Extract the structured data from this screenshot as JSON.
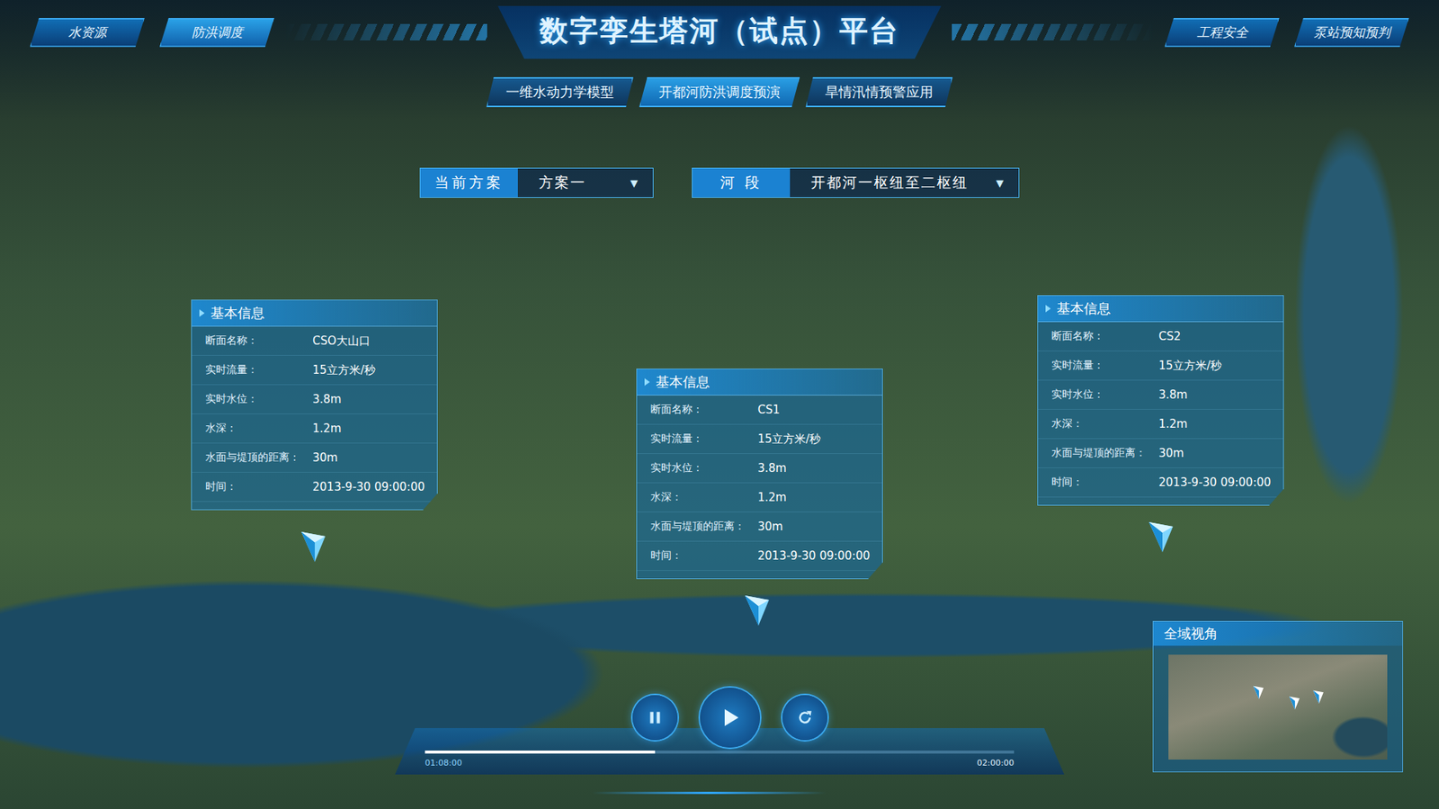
{
  "window": {
    "title": "数字孪生塔河（试点）平台"
  },
  "nav_left": [
    {
      "label": "水资源",
      "selected": false
    },
    {
      "label": "防洪调度",
      "selected": true
    }
  ],
  "nav_right": [
    {
      "label": "工程安全",
      "selected": false
    },
    {
      "label": "泵站预知预判",
      "selected": false
    }
  ],
  "sub_tabs": [
    {
      "label": "一维水动力学模型",
      "selected": false
    },
    {
      "label": "开都河防洪调度预演",
      "selected": true
    },
    {
      "label": "旱情汛情预警应用",
      "selected": false
    }
  ],
  "selectors": [
    {
      "label": "当前方案",
      "value": "方案一",
      "arrow": "▼"
    },
    {
      "label": "河 段",
      "value": "开都河一枢纽至二枢纽",
      "arrow": "▼"
    }
  ],
  "info_cards": [
    {
      "title": "基本信息",
      "rows": [
        {
          "label": "断面名称：",
          "value": "CSO大山口"
        },
        {
          "label": "实时流量：",
          "value": "15立方米/秒"
        },
        {
          "label": "实时水位：",
          "value": "3.8m"
        },
        {
          "label": "水深：",
          "value": "1.2m"
        },
        {
          "label": "水面与堤顶的距离：",
          "value": "30m"
        },
        {
          "label": "时间：",
          "value": "2013-9-30 09:00:00"
        }
      ]
    },
    {
      "title": "基本信息",
      "rows": [
        {
          "label": "断面名称：",
          "value": "CS1"
        },
        {
          "label": "实时流量：",
          "value": "15立方米/秒"
        },
        {
          "label": "实时水位：",
          "value": "3.8m"
        },
        {
          "label": "水深：",
          "value": "1.2m"
        },
        {
          "label": "水面与堤顶的距离：",
          "value": "30m"
        },
        {
          "label": "时间：",
          "value": "2013-9-30 09:00:00"
        }
      ]
    },
    {
      "title": "基本信息",
      "rows": [
        {
          "label": "断面名称：",
          "value": "CS2"
        },
        {
          "label": "实时流量：",
          "value": "15立方米/秒"
        },
        {
          "label": "实时水位：",
          "value": "3.8m"
        },
        {
          "label": "水深：",
          "value": "1.2m"
        },
        {
          "label": "水面与堤顶的距离：",
          "value": "30m"
        },
        {
          "label": "时间：",
          "value": "2013-9-30 09:00:00"
        }
      ]
    }
  ],
  "overview": {
    "title": "全域视角"
  },
  "player": {
    "buttons": [
      {
        "kind": "pause"
      },
      {
        "kind": "play"
      },
      {
        "kind": "replay"
      }
    ],
    "level": 0.39,
    "start": "01:08:00",
    "end": "02:00:00"
  }
}
